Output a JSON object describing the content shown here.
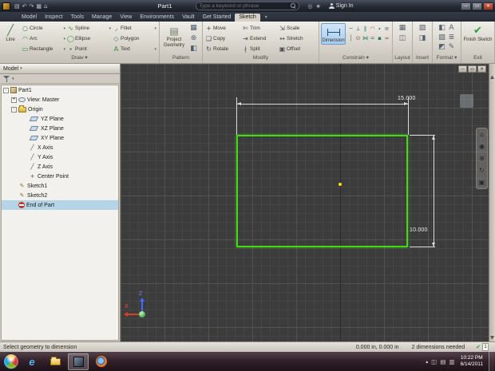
{
  "titlebar": {
    "title": "Part1",
    "qat_icons": [
      "▤",
      "↶",
      "↷",
      "▦",
      "⌂"
    ],
    "search": {
      "placeholder": "Type a keyword or phrase"
    },
    "right_icons": [
      "◎",
      "★"
    ],
    "sign_in_label": "Sign In",
    "window_buttons": {
      "minimize": "─",
      "maximize": "▭",
      "close": "✕"
    }
  },
  "tabs": {
    "items": [
      {
        "label": "Model"
      },
      {
        "label": "Inspect"
      },
      {
        "label": "Tools"
      },
      {
        "label": "Manage"
      },
      {
        "label": "View"
      },
      {
        "label": "Environments"
      },
      {
        "label": "Vault"
      },
      {
        "label": "Get Started"
      },
      {
        "label": "Sketch"
      }
    ],
    "active_label": "Sketch",
    "toggle_glyph": "▾"
  },
  "ribbon": {
    "line_tool": {
      "glyph": "╱",
      "label": "Line"
    },
    "draw_tools": [
      {
        "glyph": "○",
        "label": "Circle",
        "arrow": "▾"
      },
      {
        "glyph": "∿",
        "label": "Spline",
        "arrow": "▾"
      },
      {
        "glyph": "◞",
        "label": "Fillet",
        "arrow": "▾"
      },
      {
        "glyph": "◠",
        "label": "Arc",
        "arrow": "▾"
      },
      {
        "glyph": "◯",
        "label": "Ellipse",
        "arrow": ""
      },
      {
        "glyph": "◇",
        "label": "Polygon",
        "arrow": ""
      },
      {
        "glyph": "▭",
        "label": "Rectangle",
        "arrow": "▾"
      },
      {
        "glyph": "∙",
        "label": "Point",
        "arrow": ""
      },
      {
        "glyph": "A",
        "label": "Text",
        "arrow": "▾"
      }
    ],
    "project_geometry": {
      "glyph": "▤",
      "label": "Project Geometry"
    },
    "pattern_icons": [
      "▦",
      "⊛",
      "◧"
    ],
    "modify_tools": [
      {
        "glyph": "+",
        "label": "Move"
      },
      {
        "glyph": "✄",
        "label": "Trim"
      },
      {
        "glyph": "⇲",
        "label": "Scale"
      },
      {
        "glyph": "❏",
        "label": "Copy"
      },
      {
        "glyph": "⇥",
        "label": "Extend"
      },
      {
        "glyph": "↔",
        "label": "Stretch"
      },
      {
        "glyph": "↻",
        "label": "Rotate"
      },
      {
        "glyph": "∤",
        "label": "Split"
      },
      {
        "glyph": "▣",
        "label": "Offset"
      }
    ],
    "dimension_tool": {
      "label": "Dimension"
    },
    "constraint_icons": [
      "─",
      "⟂",
      "∥",
      "◠",
      "∙",
      "≡",
      "│",
      "⊙",
      "⋈",
      "=",
      "▪",
      "≈"
    ],
    "layout_icons": [
      "▦",
      "◫"
    ],
    "insert_icons": [
      "▧",
      "◨"
    ],
    "format_icons": [
      "◧",
      "A",
      "▨",
      "≣",
      "◩",
      "✎"
    ],
    "finish_tool": {
      "glyph": "✔",
      "label": "Finish Sketch"
    },
    "group_labels": {
      "draw": "Draw ▾",
      "pattern": "Pattern",
      "modify": "Modify",
      "constrain": "Constrain ▾",
      "layout": "Layout",
      "insert": "Insert",
      "format": "Format ▾",
      "exit": "Exit"
    }
  },
  "browser": {
    "header_label": "Model",
    "header_arrow": "▾",
    "tree": [
      {
        "label": "Part1",
        "exp": "-"
      },
      {
        "label": "View: Master",
        "exp": "+"
      },
      {
        "label": "Origin",
        "exp": "-"
      },
      {
        "label": "YZ Plane"
      },
      {
        "label": "XZ Plane"
      },
      {
        "label": "XY Plane"
      },
      {
        "label": "X Axis",
        "icon_glyph": "╱"
      },
      {
        "label": "Y Axis",
        "icon_glyph": "╱"
      },
      {
        "label": "Z Axis",
        "icon_glyph": "╱"
      },
      {
        "label": "Center Point",
        "icon_glyph": "+"
      },
      {
        "label": "Sketch1",
        "icon_glyph": "✎"
      },
      {
        "label": "Sketch2",
        "icon_glyph": "✎"
      },
      {
        "label": "End of Part"
      }
    ]
  },
  "canvas": {
    "doc_buttons": [
      "─",
      "▭",
      "✕"
    ],
    "nav_icons": [
      "⌂",
      "◉",
      "⊕",
      "↻",
      "▣"
    ],
    "dim_width_label": "15.000",
    "dim_height_label": "10.000",
    "triad": {
      "z": "Z",
      "x": "X"
    }
  },
  "statusbar": {
    "message": "Select geometry to dimension",
    "coordinates": "0.000 in, 0.000 in",
    "hint": "2 dimensions needed",
    "check_glyph": "✔",
    "badge": "1"
  },
  "taskbar": {
    "ie_glyph": "e",
    "tray_expand": "▴",
    "tray_icons": [
      "◫",
      "▤",
      "▥"
    ],
    "clock": {
      "time": "10:22 PM",
      "date": "6/14/2011"
    }
  },
  "colors": {
    "sketch_green": "#3fdc10",
    "dimension_white": "#dcdcdc",
    "selection_blue": "#b4d4e8",
    "dimension_button_highlight": "#a6cbee",
    "canvas_background": "#3c3c3c"
  }
}
